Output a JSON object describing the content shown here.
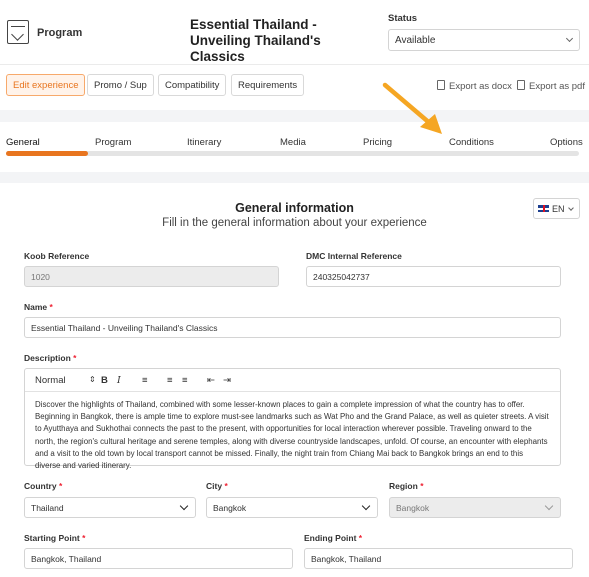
{
  "header": {
    "program_label": "Program",
    "title": "Essential Thailand - Unveiling Thailand's Classics",
    "status_label": "Status",
    "status_value": "Available"
  },
  "toolbar": {
    "edit_experience": "Edit experience",
    "promo": "Promo / Sup",
    "compatibility": "Compatibility",
    "requirements": "Requirements",
    "export_docx": "Export as docx",
    "export_pdf": "Export as pdf"
  },
  "tabs": [
    "General",
    "Program",
    "Itinerary",
    "Media",
    "Pricing",
    "Conditions",
    "Options"
  ],
  "active_tab": "General",
  "section": {
    "title": "General information",
    "subtitle": "Fill in the general information about your experience",
    "language": "EN"
  },
  "form": {
    "koob_ref_label": "Koob Reference",
    "koob_ref_value": "1020",
    "dmc_ref_label": "DMC Internal Reference",
    "dmc_ref_value": "240325042737",
    "name_label": "Name",
    "name_value": "Essential Thailand - Unveiling Thailand's Classics",
    "description_label": "Description",
    "editor_format": "Normal",
    "description_value": "Discover the highlights of Thailand, combined with some lesser-known places to gain a complete impression of what the country has to offer. Beginning in Bangkok, there is ample time to explore must-see landmarks such as Wat Pho and the Grand Palace, as well as quieter streets. A visit to Ayutthaya and Sukhothai connects the past to the present, with opportunities for local interaction wherever possible. Traveling onward to the north, the region's cultural heritage and serene temples, along with diverse countryside landscapes, unfold. Of course, an encounter with elephants and a visit to the old town by local transport cannot be missed. Finally, the night train from Chiang Mai back to Bangkok brings an end to this diverse and varied itinerary.",
    "country_label": "Country",
    "country_value": "Thailand",
    "city_label": "City",
    "city_value": "Bangkok",
    "region_label": "Region",
    "region_value": "Bangkok",
    "starting_point_label": "Starting Point",
    "starting_point_value": "Bangkok, Thailand",
    "ending_point_label": "Ending Point",
    "ending_point_value": "Bangkok, Thailand",
    "required_mark": "*"
  },
  "colors": {
    "accent": "#e8751f",
    "arrow": "#f5a623",
    "required": "#e23333"
  }
}
